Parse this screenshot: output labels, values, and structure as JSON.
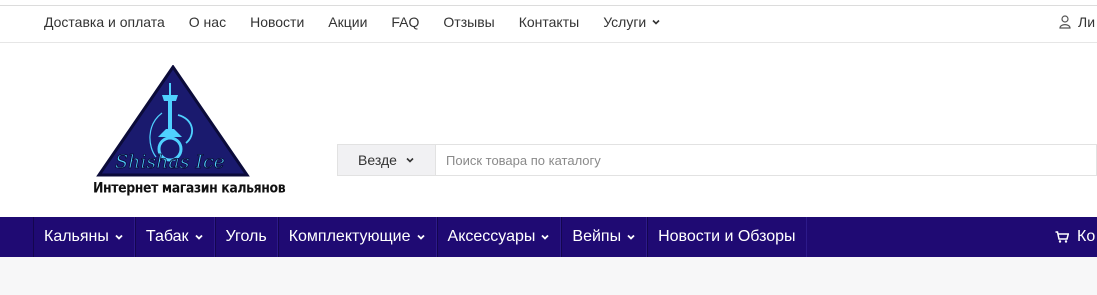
{
  "top_nav": {
    "items": [
      {
        "label": "Доставка и оплата"
      },
      {
        "label": "О нас"
      },
      {
        "label": "Новости"
      },
      {
        "label": "Акции"
      },
      {
        "label": "FAQ"
      },
      {
        "label": "Отзывы"
      },
      {
        "label": "Контакты"
      },
      {
        "label": "Услуги",
        "icon": "chevron-down-icon"
      }
    ],
    "login": {
      "label": "Ли",
      "icon": "user-icon"
    }
  },
  "logo": {
    "brand": "Shishas Ice",
    "subtitle": "Интернет магазин кальянов",
    "colors": {
      "triangle": "#1a1a6e",
      "hookah": "#4fd1ff"
    }
  },
  "search": {
    "scope_label": "Везде",
    "scope_icon": "chevron-down-icon",
    "placeholder": "Поиск товара по каталогу",
    "value": ""
  },
  "main_nav": {
    "items": [
      {
        "label": "Кальяны",
        "has_dropdown": true
      },
      {
        "label": "Табак",
        "has_dropdown": true
      },
      {
        "label": "Уголь",
        "has_dropdown": false
      },
      {
        "label": "Комплектующие",
        "has_dropdown": true
      },
      {
        "label": "Аксессуары",
        "has_dropdown": true
      },
      {
        "label": "Вейпы",
        "has_dropdown": true
      },
      {
        "label": "Новости и Обзоры",
        "has_dropdown": false
      }
    ],
    "cart": {
      "label": "Ко",
      "icon": "cart-icon"
    }
  },
  "colors": {
    "nav_background": "#1f0a73",
    "page_background": "#f7f7f8",
    "text": "#333333"
  }
}
